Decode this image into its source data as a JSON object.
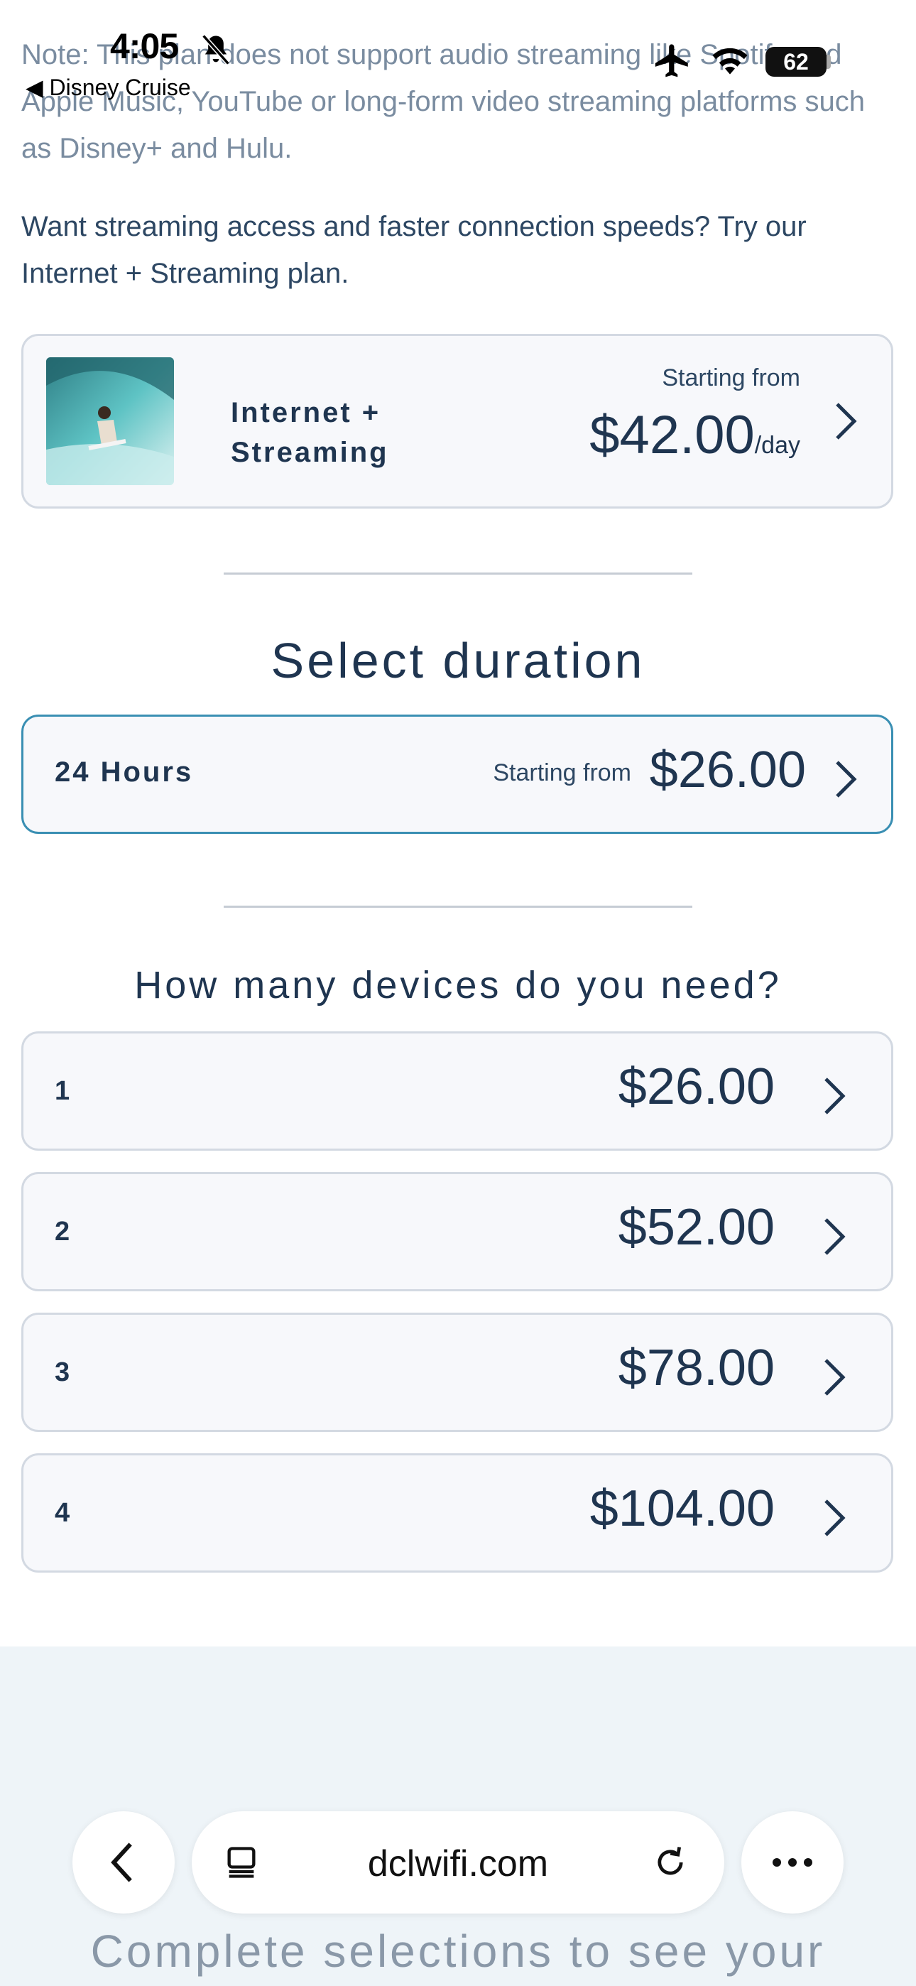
{
  "status_bar": {
    "time": "4:05",
    "back_app": "◀ Disney Cruise",
    "battery": "62"
  },
  "content": {
    "note": "Note: This plan does not support audio streaming like Spotify and Apple Music, YouTube or long-form video streaming platforms such as Disney+ and Hulu.",
    "upsell": "Want streaming access and faster connection speeds? Try our Internet + Streaming plan.",
    "plan_card": {
      "name": "Internet + Streaming",
      "from_label": "Starting from",
      "price": "$42.00",
      "unit": "/day"
    },
    "duration_title": "Select duration",
    "duration": {
      "label": "24 Hours",
      "from_label": "Starting from",
      "price": "$26.00"
    },
    "devices_title": "How many devices do you need?",
    "devices": [
      {
        "count": "1",
        "price": "$26.00"
      },
      {
        "count": "2",
        "price": "$52.00"
      },
      {
        "count": "3",
        "price": "$78.00"
      },
      {
        "count": "4",
        "price": "$104.00"
      }
    ],
    "complete_text": "Complete selections to see your"
  },
  "browser": {
    "url": "dclwifi.com"
  },
  "colors": {
    "text": "#1f3550",
    "accent_border": "#3a8fb3",
    "card_bg": "#f7f8fb"
  }
}
